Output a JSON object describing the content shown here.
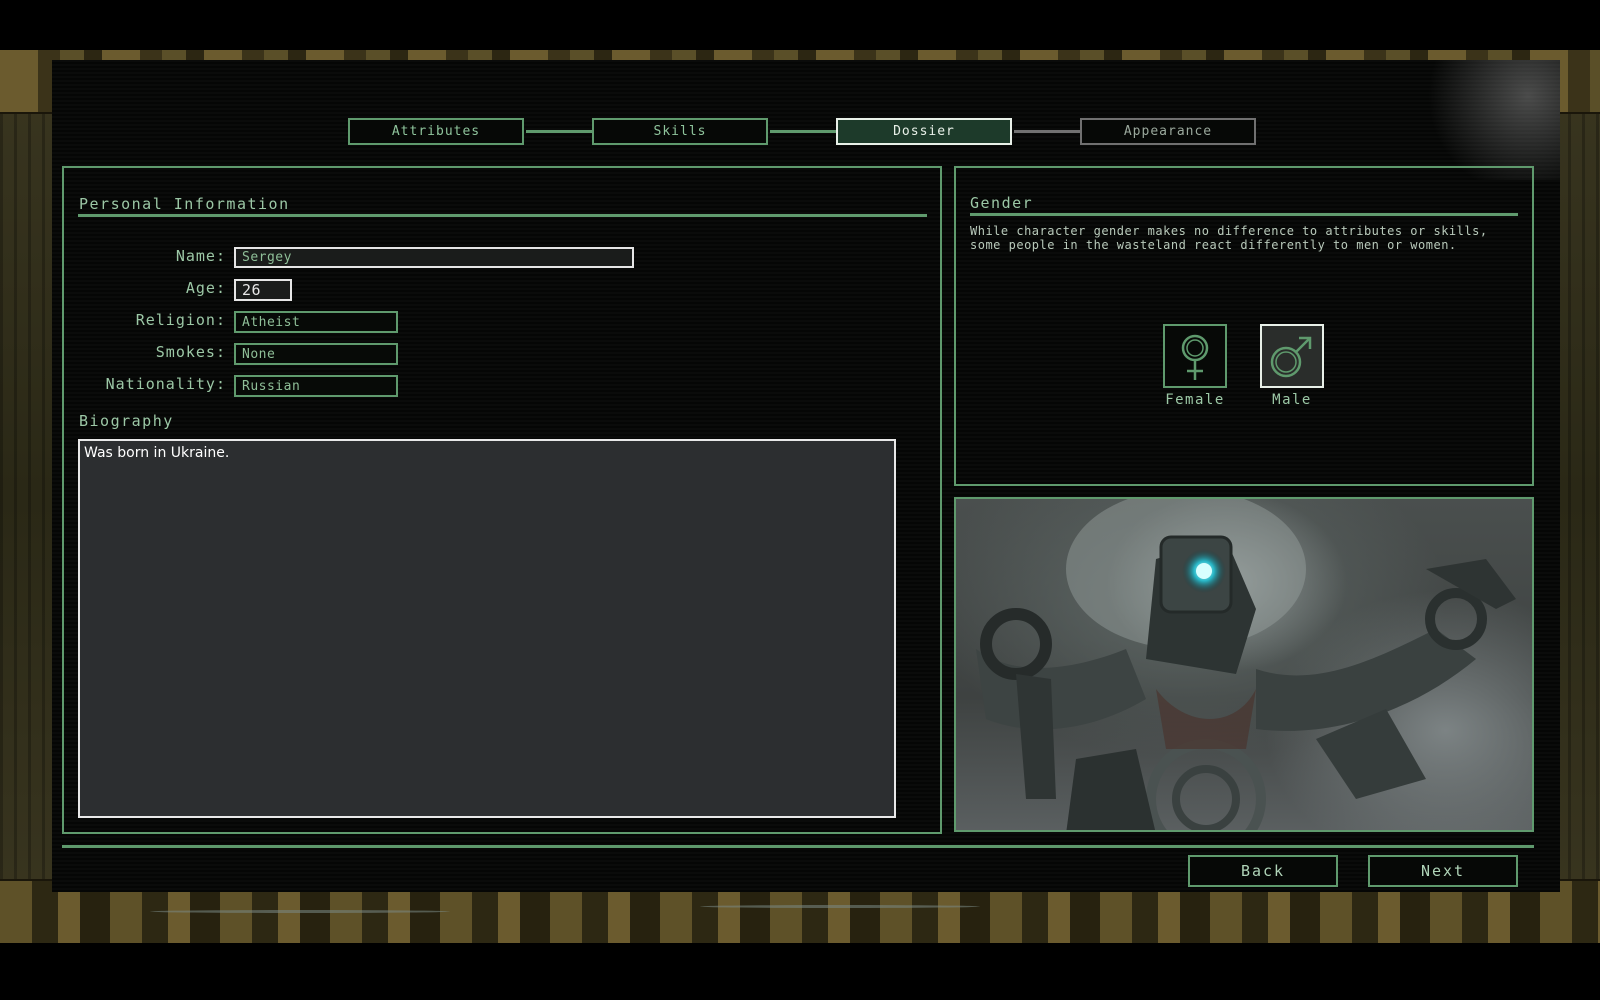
{
  "tabs": [
    {
      "label": "Attributes",
      "state": "completed"
    },
    {
      "label": "Skills",
      "state": "completed"
    },
    {
      "label": "Dossier",
      "state": "active"
    },
    {
      "label": "Appearance",
      "state": "pending"
    }
  ],
  "personal": {
    "title": "Personal Information",
    "name_label": "Name:",
    "name_value": "Sergey",
    "age_label": "Age:",
    "age_value": "26",
    "religion_label": "Religion:",
    "religion_value": "Atheist",
    "smokes_label": "Smokes:",
    "smokes_value": "None",
    "nationality_label": "Nationality:",
    "nationality_value": "Russian"
  },
  "biography": {
    "title": "Biography",
    "text": "Was born in Ukraine."
  },
  "gender": {
    "title": "Gender",
    "description": "While character gender makes no difference to attributes or skills, some people in the wasteland react differently to men or women.",
    "female_label": "Female",
    "male_label": "Male",
    "selected": "Male"
  },
  "footer": {
    "back_label": "Back",
    "next_label": "Next"
  },
  "colors": {
    "accent": "#5f9a6d",
    "highlight": "#e8f0e8",
    "active_tab_bg": "#1d3a2a"
  }
}
